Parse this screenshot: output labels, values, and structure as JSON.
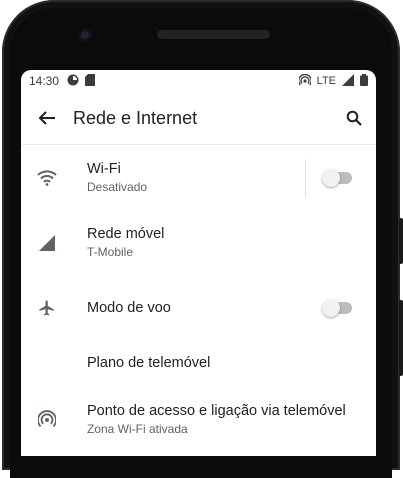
{
  "status_bar": {
    "time": "14:30",
    "network": "LTE"
  },
  "app_bar": {
    "title": "Rede e Internet"
  },
  "items": [
    {
      "name": "wifi",
      "title": "Wi-Fi",
      "subtitle": "Desativado",
      "toggle": false
    },
    {
      "name": "mobile-network",
      "title": "Rede móvel",
      "subtitle": "T-Mobile"
    },
    {
      "name": "airplane-mode",
      "title": "Modo de voo",
      "toggle": false
    },
    {
      "name": "mobile-plan",
      "title": "Plano de telemóvel"
    },
    {
      "name": "hotspot",
      "title": "Ponto de acesso e ligação via telemóvel",
      "subtitle": "Zona Wi-Fi ativada"
    }
  ],
  "colors": {
    "text_primary": "#202124",
    "text_secondary": "#5f6368",
    "icon": "#5f6368"
  }
}
